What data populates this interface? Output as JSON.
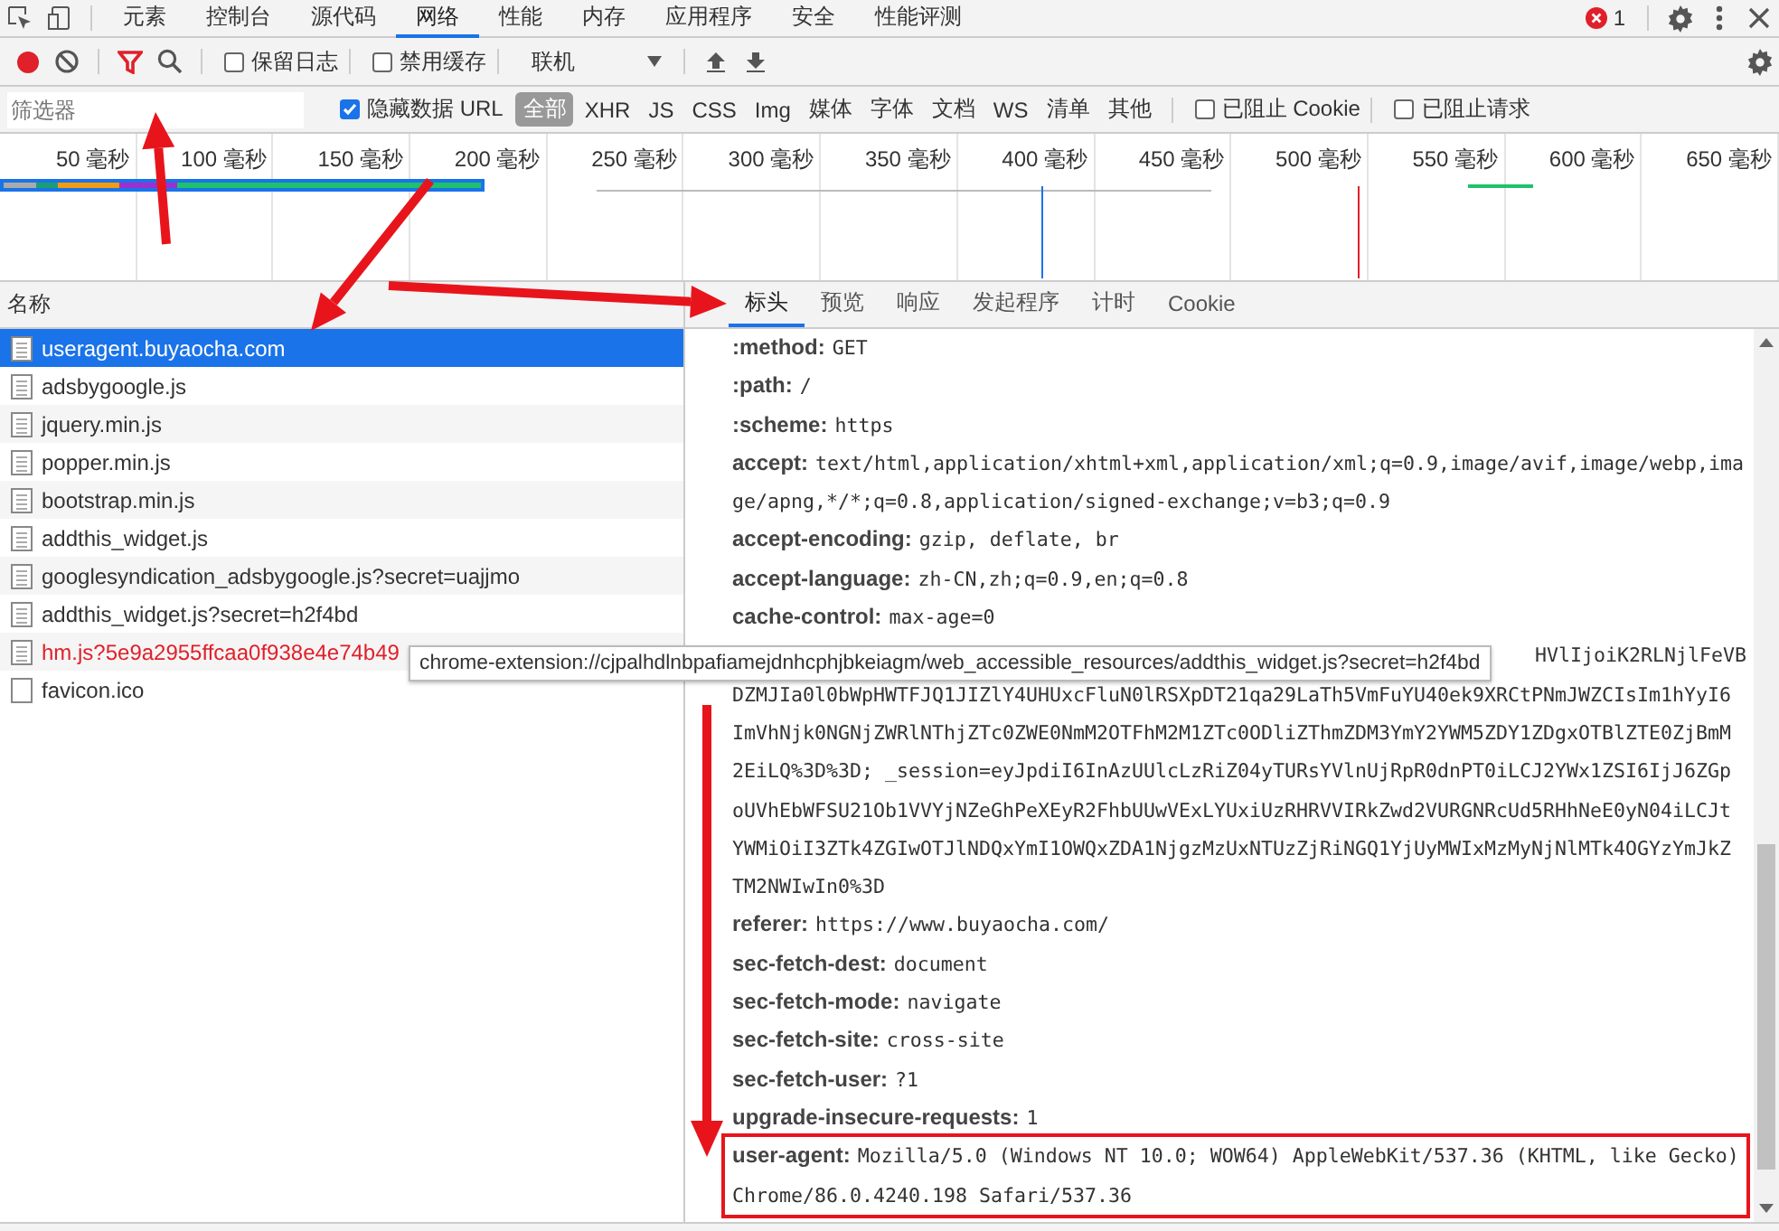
{
  "main_tabs": {
    "tabs": [
      {
        "label": "元素",
        "selected": false
      },
      {
        "label": "控制台",
        "selected": false
      },
      {
        "label": "源代码",
        "selected": false
      },
      {
        "label": "网络",
        "selected": true
      },
      {
        "label": "性能",
        "selected": false
      },
      {
        "label": "内存",
        "selected": false
      },
      {
        "label": "应用程序",
        "selected": false
      },
      {
        "label": "安全",
        "selected": false
      },
      {
        "label": "性能评测",
        "selected": false
      }
    ],
    "error_count": "1"
  },
  "network_toolbar": {
    "recording": true,
    "filter_active": true,
    "preserve_log": {
      "label": "保留日志",
      "checked": false
    },
    "disable_cache": {
      "label": "禁用缓存",
      "checked": false
    },
    "throttling": "联机"
  },
  "filter_bar": {
    "placeholder": "筛选器",
    "hide_data_urls": {
      "label": "隐藏数据 URL",
      "checked": true
    },
    "types": [
      {
        "label": "全部",
        "selected": true
      },
      {
        "label": "XHR",
        "selected": false
      },
      {
        "label": "JS",
        "selected": false
      },
      {
        "label": "CSS",
        "selected": false
      },
      {
        "label": "Img",
        "selected": false
      },
      {
        "label": "媒体",
        "selected": false
      },
      {
        "label": "字体",
        "selected": false
      },
      {
        "label": "文档",
        "selected": false
      },
      {
        "label": "WS",
        "selected": false
      },
      {
        "label": "清单",
        "selected": false
      },
      {
        "label": "其他",
        "selected": false
      }
    ],
    "blocked_cookies": {
      "label": "已阻止 Cookie",
      "checked": false
    },
    "blocked_requests": {
      "label": "已阻止请求",
      "checked": false
    }
  },
  "timeline": {
    "ticks": [
      "50 毫秒",
      "100 毫秒",
      "150 毫秒",
      "200 毫秒",
      "250 毫秒",
      "300 毫秒",
      "350 毫秒",
      "400 毫秒",
      "450 毫秒",
      "500 毫秒",
      "550 毫秒",
      "600 毫秒",
      "650 毫秒"
    ]
  },
  "requests": {
    "column": "名称",
    "rows": [
      {
        "name": "useragent.buyaocha.com",
        "kind": "document",
        "selected": true,
        "failed": false
      },
      {
        "name": "adsbygoogle.js",
        "kind": "document",
        "selected": false,
        "failed": false
      },
      {
        "name": "jquery.min.js",
        "kind": "document",
        "selected": false,
        "failed": false
      },
      {
        "name": "popper.min.js",
        "kind": "document",
        "selected": false,
        "failed": false
      },
      {
        "name": "bootstrap.min.js",
        "kind": "document",
        "selected": false,
        "failed": false
      },
      {
        "name": "addthis_widget.js",
        "kind": "document",
        "selected": false,
        "failed": false
      },
      {
        "name": "googlesyndication_adsbygoogle.js?secret=uajjmo",
        "kind": "document",
        "selected": false,
        "failed": false
      },
      {
        "name": "addthis_widget.js?secret=h2f4bd",
        "kind": "document",
        "selected": false,
        "failed": false
      },
      {
        "name": "hm.js?5e9a2955ffcaa0f938e4e74b49",
        "kind": "document",
        "selected": false,
        "failed": true
      },
      {
        "name": "favicon.ico",
        "kind": "image",
        "selected": false,
        "failed": false
      }
    ]
  },
  "tooltip": "chrome-extension://cjpalhdlnbpafiamejdnhcphjbkeiagm/web_accessible_resources/addthis_widget.js?secret=h2f4bd",
  "details": {
    "tabs": [
      {
        "label": "标头",
        "selected": true
      },
      {
        "label": "预览",
        "selected": false
      },
      {
        "label": "响应",
        "selected": false
      },
      {
        "label": "发起程序",
        "selected": false
      },
      {
        "label": "计时",
        "selected": false
      },
      {
        "label": "Cookie",
        "selected": false
      }
    ],
    "headers": [
      {
        "kind": "header",
        "name": ":method:",
        "value": "GET",
        "highlighted": false
      },
      {
        "kind": "header",
        "name": ":path:",
        "value": "/",
        "highlighted": false
      },
      {
        "kind": "header",
        "name": ":scheme:",
        "value": "https",
        "highlighted": false
      },
      {
        "kind": "header",
        "name": "accept:",
        "value": "text/html,application/xhtml+xml,application/xml;q=0.9,image/avif,image/webp,image/apng,*/*;q=0.8,application/signed-exchange;v=b3;q=0.9",
        "highlighted": false
      },
      {
        "kind": "header",
        "name": "accept-encoding:",
        "value": "gzip, deflate, br",
        "highlighted": false
      },
      {
        "kind": "header",
        "name": "accept-language:",
        "value": "zh-CN,zh;q=0.9,en;q=0.8",
        "highlighted": false
      },
      {
        "kind": "header",
        "name": "cache-control:",
        "value": "max-age=0",
        "highlighted": false
      },
      {
        "kind": "fragment",
        "lines": [
          "HVlIjoiK2RLNjlFeVB",
          "DZMJIa0l0bWpHWTFJQ1JIZlY4UHUxcFluN0lRSXpDT21qa29LaTh5VmFuYU40ek9XRCtPNmJWZCIsIm1hYyI6",
          "ImVhNjk0NGNjZWRlNThjZTc0ZWE0NmM2OTFhM2M1ZTc0ODliZThmZDM3YmY2YWM5ZDY1ZDgxOTBlZTE0ZjBmM",
          "2EiLQ%3D%3D; _session=eyJpdiI6InAzUUlcLzRiZ04yTURsYVlnUjRpR0dnPT0iLCJ2YWx1ZSI6IjJ6ZGp",
          "oUVhEbWFSU21Ob1VVYjNZeGhPeXEyR2FhbUUwVExLYUxiUzRHRVVIRkZwd2VURGNRcUd5RHhNeE0yN04iLCJt",
          "YWMiOiI3ZTk4ZGIwOTJlNDQxYmI1OWQxZDA1NjgzMzUxNTUzZjRiNGQ1YjUyMWIxMzMyNjNlMTk4OGYzYmJkZ",
          "TM2NWIwIn0%3D"
        ]
      },
      {
        "kind": "header",
        "name": "referer:",
        "value": "https://www.buyaocha.com/",
        "highlighted": false
      },
      {
        "kind": "header",
        "name": "sec-fetch-dest:",
        "value": "document",
        "highlighted": false
      },
      {
        "kind": "header",
        "name": "sec-fetch-mode:",
        "value": "navigate",
        "highlighted": false
      },
      {
        "kind": "header",
        "name": "sec-fetch-site:",
        "value": "cross-site",
        "highlighted": false
      },
      {
        "kind": "header",
        "name": "sec-fetch-user:",
        "value": "?1",
        "highlighted": false
      },
      {
        "kind": "header",
        "name": "upgrade-insecure-requests:",
        "value": "1",
        "highlighted": false
      },
      {
        "kind": "header",
        "name": "user-agent:",
        "value": "Mozilla/5.0 (Windows NT 10.0; WOW64) AppleWebKit/537.36 (KHTML, like Gecko) Chrome/86.0.4240.198 Safari/537.36",
        "highlighted": true
      }
    ]
  }
}
